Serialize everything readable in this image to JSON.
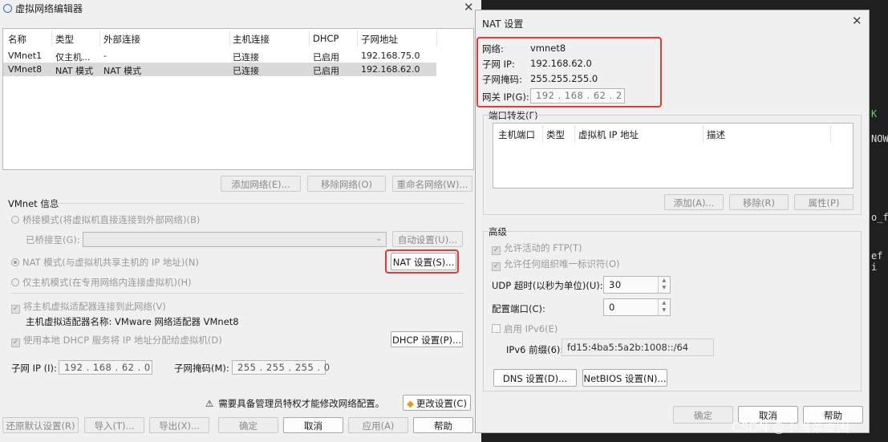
{
  "vne": {
    "title": "虚拟网络编辑器",
    "columns": [
      "名称",
      "类型",
      "外部连接",
      "主机连接",
      "DHCP",
      "子网地址"
    ],
    "rows": [
      [
        "VMnet1",
        "仅主机...",
        "-",
        "已连接",
        "已启用",
        "192.168.75.0"
      ],
      [
        "VMnet8",
        "NAT 模式",
        "NAT 模式",
        "已连接",
        "已启用",
        "192.168.62.0"
      ]
    ],
    "add_network": "添加网络(E)...",
    "remove_network": "移除网络(O)",
    "rename_network": "重命名网络(W)...",
    "vmnet_info": "VMnet 信息",
    "bridged": "桥接模式(将虚拟机直接连接到外部网络)(B)",
    "bridged_to": "已桥接至(G):",
    "auto_settings": "自动设置(U)...",
    "nat_mode": "NAT 模式(与虚拟机共享主机的 IP 地址)(N)",
    "nat_settings": "NAT 设置(S)...",
    "host_only": "仅主机模式(在专用网络内连接虚拟机)(H)",
    "connect_adapter": "将主机虚拟适配器连接到此网络(V)",
    "adapter_name": "主机虚拟适配器名称: VMware 网络适配器 VMnet8",
    "use_dhcp": "使用本地 DHCP 服务将 IP 地址分配给虚拟机(D)",
    "dhcp_settings": "DHCP 设置(P)...",
    "subnet_ip_label": "子网 IP (I):",
    "subnet_ip": "192 . 168 . 62 . 0",
    "subnet_mask_label": "子网掩码(M):",
    "subnet_mask": "255 . 255 . 255 . 0",
    "admin_notice": "需要具备管理员特权才能修改网络配置。",
    "change_settings": "更改设置(C)",
    "restore_defaults": "还原默认设置(R)",
    "import": "导入(T)...",
    "export": "导出(X)...",
    "ok": "确定",
    "cancel": "取消",
    "apply": "应用(A)",
    "help": "帮助"
  },
  "nat": {
    "title": "NAT 设置",
    "network_label": "网络:",
    "network": "vmnet8",
    "subnet_ip_label": "子网 IP:",
    "subnet_ip": "192.168.62.0",
    "subnet_mask_label": "子网掩码:",
    "subnet_mask": "255.255.255.0",
    "gateway_label": "网关 IP(G):",
    "gateway": "192 . 168 . 62 . 2",
    "port_forwarding": "端口转发(F)",
    "pf_columns": [
      "主机端口",
      "类型",
      "虚拟机 IP 地址",
      "描述"
    ],
    "pf_add": "添加(A)...",
    "pf_remove": "移除(R)",
    "pf_properties": "属性(P)",
    "advanced": "高级",
    "allow_ftp": "允许活动的 FTP(T)",
    "allow_uuid": "允许任何组织唯一标识符(O)",
    "udp_timeout_label": "UDP 超时(以秒为单位)(U):",
    "udp_timeout": "30",
    "config_port_label": "配置端口(C):",
    "config_port": "0",
    "enable_ipv6": "启用 IPv6(E)",
    "ipv6_prefix_label": "IPv6 前缀(6):",
    "ipv6_prefix": "fd15:4ba5:5a2b:1008::/64",
    "dns_settings": "DNS 设置(D)...",
    "netbios_settings": "NetBIOS 设置(N)...",
    "ok": "确定",
    "cancel": "取消",
    "help": "帮助"
  },
  "background": {
    "line1": "K",
    "line2": "NOW",
    "line3": "o_f",
    "line4": "ef i"
  },
  "watermark": "CSDN @不当菜虚困",
  "colors": {
    "highlight_red": "#e53935",
    "selected_row": "#d9d9d9",
    "accent": "#3c78d8"
  }
}
